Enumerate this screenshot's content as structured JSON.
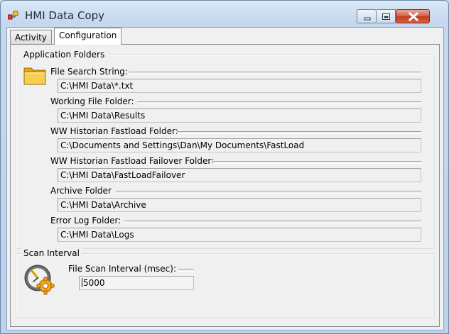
{
  "window": {
    "title": "HMI Data Copy"
  },
  "tabs": [
    {
      "label": "Activity"
    },
    {
      "label": "Configuration"
    }
  ],
  "app_folders": {
    "title": "Application Folders",
    "fields": [
      {
        "label": "File Search String:",
        "value": "C:\\HMI Data\\*.txt"
      },
      {
        "label": "Working File Folder:",
        "value": "C:\\HMI Data\\Results"
      },
      {
        "label": "WW Historian Fastload Folder:",
        "value": "C:\\Documents and Settings\\Dan\\My Documents\\FastLoad"
      },
      {
        "label": "WW Historian Fastload Failover Folder:",
        "value": "C:\\HMI Data\\FastLoadFailover"
      },
      {
        "label": "Archive Folder",
        "value": "C:\\HMI Data\\Archive"
      },
      {
        "label": "Error Log Folder:",
        "value": "C:\\HMI Data\\Logs"
      }
    ]
  },
  "scan_interval": {
    "title": "Scan Interval",
    "label": "File Scan Interval (msec):",
    "value": "5000"
  },
  "icons": {
    "app": "app-icon",
    "folder": "folder-icon",
    "clock": "clock-gear-icon",
    "minimize": "minimize-icon",
    "maximize": "maximize-icon",
    "close": "close-icon"
  },
  "colors": {
    "title_bar": "#c5d8ee",
    "close_button": "#c94b32",
    "folder": "#f5c242"
  }
}
